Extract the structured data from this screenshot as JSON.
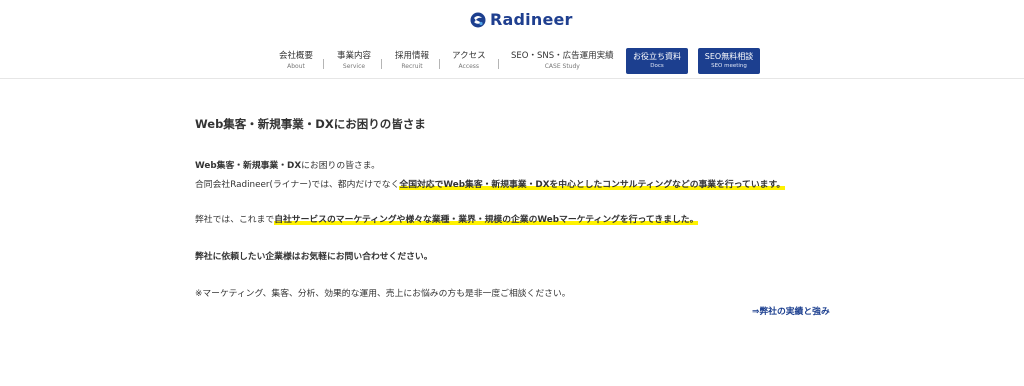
{
  "header": {
    "logo_text": "Radineer",
    "nav": [
      {
        "jp": "会社概要",
        "en": "About"
      },
      {
        "jp": "事業内容",
        "en": "Service"
      },
      {
        "jp": "採用情報",
        "en": "Recruit"
      },
      {
        "jp": "アクセス",
        "en": "Access"
      },
      {
        "jp": "SEO・SNS・広告運用実績",
        "en": "CASE Study"
      }
    ],
    "buttons": [
      {
        "jp": "お役立ち資料",
        "en": "Docs"
      },
      {
        "jp": "SEO無料相談",
        "en": "SEO meeting"
      }
    ],
    "brand_color": "#1c3f8f"
  },
  "main": {
    "title": "Web集客・新規事業・DXにお困りの皆さま",
    "p1": {
      "bold": "Web集客・新規事業・DX",
      "rest": "にお困りの皆さま。"
    },
    "p2": {
      "pre": "合同会社Radineer(ライナー)では、都内だけでなく",
      "highlight": "全国対応でWeb集客・新規事業・DXを中心としたコンサルティングなどの事業を行っています。"
    },
    "p3": {
      "pre": "弊社では、これまで",
      "highlight": "自社サービスのマーケティングや様々な業種・業界・規模の企業のWebマーケティングを行ってきました。"
    },
    "p4": "弊社に依頼したい企業様はお気軽にお問い合わせください。",
    "p5": "※マーケティング、集客、分析、効果的な運用、売上にお悩みの方も是非一度ご相談ください。",
    "link": "⇒弊社の実績と強み",
    "highlight_color": "#fff200"
  }
}
